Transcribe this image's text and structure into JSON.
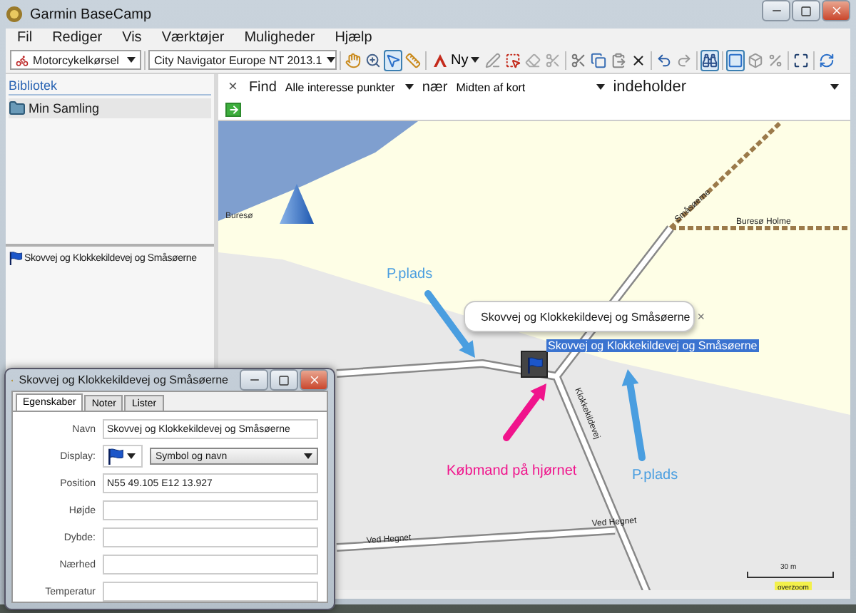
{
  "window": {
    "title": "Garmin BaseCamp"
  },
  "menu": [
    "Fil",
    "Rediger",
    "Vis",
    "Værktøjer",
    "Muligheder",
    "Hjælp"
  ],
  "toolbar": {
    "profile": "Motorcykelkørsel",
    "map": "City Navigator Europe NT 2013.1",
    "new_label": "Ny",
    "tools": [
      {
        "kind": "hand",
        "selected": false
      },
      {
        "kind": "zoom",
        "selected": false
      },
      {
        "kind": "pointer",
        "selected": true
      },
      {
        "kind": "ruler",
        "selected": false
      },
      {
        "kind": "new"
      },
      {
        "kind": "pen",
        "selected": false
      },
      {
        "kind": "select",
        "selected": false
      },
      {
        "kind": "eraser",
        "selected": false
      },
      {
        "kind": "scissors",
        "selected": false
      },
      {
        "kind": "cut",
        "selected": false
      },
      {
        "kind": "copy",
        "selected": false
      },
      {
        "kind": "paste",
        "selected": false
      },
      {
        "kind": "delete",
        "selected": false
      },
      {
        "kind": "undo",
        "selected": false
      },
      {
        "kind": "redo",
        "selected": false
      },
      {
        "kind": "find",
        "selected": true
      },
      {
        "kind": "square",
        "selected": true
      },
      {
        "kind": "cube",
        "selected": false
      },
      {
        "kind": "percent",
        "selected": false
      },
      {
        "kind": "fit",
        "selected": false
      },
      {
        "kind": "sync",
        "selected": false
      }
    ]
  },
  "library": {
    "title": "Bibliotek",
    "items": [
      {
        "label": "Min Samling",
        "selected": true
      }
    ]
  },
  "list": {
    "items": [
      {
        "label": "Skovvej og Klokkekildevej og Småsøerne"
      }
    ]
  },
  "find_bar": {
    "close": "×",
    "label": "Find",
    "category": "Alle interesse punkter",
    "near_label": "nær",
    "near": "Midten af kort",
    "match": "indeholder"
  },
  "map": {
    "place_label": "Buresø",
    "road_labels": [
      "Småsøerne",
      "Buresø Holme",
      "Klokkekildevej",
      "Ved Hegnet",
      "Ved Hegnet"
    ],
    "annotations": [
      {
        "text": "P.plads",
        "color": "#4a9ee0"
      },
      {
        "text": "P.plads",
        "color": "#4a9ee0"
      },
      {
        "text": "Købmand på hjørnet",
        "color": "#f0148c"
      }
    ],
    "waypoint": {
      "label": "Skovvej og Klokkekildevej og Småsøerne",
      "selected": true
    },
    "callout": {
      "title": "Skovvej og Klokkekildevej og Småsøerne",
      "close": "×"
    },
    "scale": {
      "distance": "30 m",
      "note": "overzoom"
    }
  },
  "dialog": {
    "title": "Skovvej og Klokkekildevej og Småsøerne",
    "tabs": [
      {
        "label": "Egenskaber",
        "selected": true
      },
      {
        "label": "Noter",
        "selected": false
      },
      {
        "label": "Lister",
        "selected": false
      }
    ],
    "fields": [
      {
        "label": "Navn",
        "kind": "text",
        "value": "Skovvej og Klokkekildevej og Småsøerne"
      },
      {
        "label": "Display:",
        "kind": "symbol",
        "value": "Symbol og navn"
      },
      {
        "label": "Position",
        "kind": "text",
        "value": "N55 49.105 E12 13.927"
      },
      {
        "label": "Højde",
        "kind": "text"
      },
      {
        "label": "Dybde:",
        "kind": "text"
      },
      {
        "label": "Nærhed",
        "kind": "text"
      },
      {
        "label": "Temperatur",
        "kind": "text"
      }
    ]
  }
}
